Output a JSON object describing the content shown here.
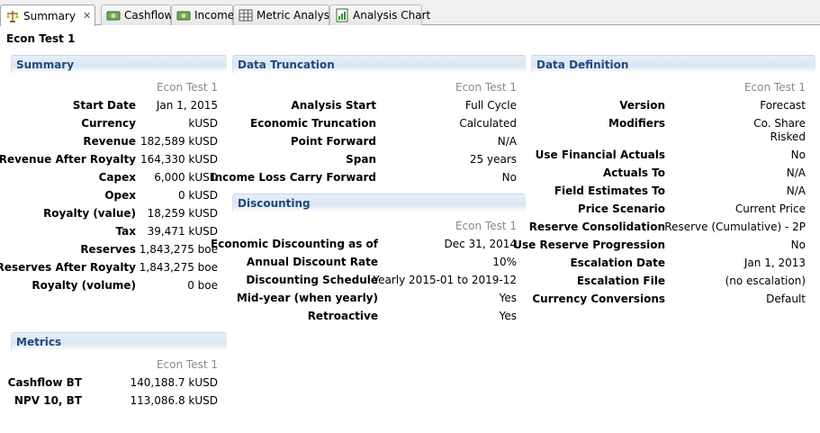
{
  "tabs": [
    {
      "label": "Summary",
      "icon": "summary-scale-icon"
    },
    {
      "label": "Cashflow",
      "icon": "money-icon"
    },
    {
      "label": "Income",
      "icon": "money-icon"
    },
    {
      "label": "Metric Analysis",
      "icon": "grid-icon"
    },
    {
      "label": "Analysis Chart",
      "icon": "chart-icon"
    }
  ],
  "page_title": "Econ Test 1",
  "column_header": "Econ Test 1",
  "summary": {
    "title": "Summary",
    "rows": [
      {
        "label": "Start Date",
        "value": "Jan 1, 2015"
      },
      {
        "label": "Currency",
        "value": "kUSD"
      },
      {
        "label": "Revenue",
        "value": "182,589 kUSD"
      },
      {
        "label": "Revenue After Royalty",
        "value": "164,330 kUSD"
      },
      {
        "label": "Capex",
        "value": "6,000 kUSD"
      },
      {
        "label": "Opex",
        "value": "0 kUSD"
      },
      {
        "label": "Royalty (value)",
        "value": "18,259 kUSD"
      },
      {
        "label": "Tax",
        "value": "39,471 kUSD"
      },
      {
        "label": "Reserves",
        "value": "1,843,275 boe"
      },
      {
        "label": "Reserves After Royalty",
        "value": "1,843,275 boe"
      },
      {
        "label": "Royalty (volume)",
        "value": "0 boe"
      }
    ]
  },
  "metrics": {
    "title": "Metrics",
    "rows": [
      {
        "label": "Cashflow BT",
        "value": "140,188.7 kUSD"
      },
      {
        "label": "NPV 10, BT",
        "value": "113,086.8 kUSD"
      }
    ]
  },
  "truncation": {
    "title": "Data Truncation",
    "rows": [
      {
        "label": "Analysis Start",
        "value": "Full Cycle"
      },
      {
        "label": "Economic Truncation",
        "value": "Calculated"
      },
      {
        "label": "Point Forward",
        "value": "N/A"
      },
      {
        "label": "Span",
        "value": "25 years"
      },
      {
        "label": "Income Loss Carry Forward",
        "value": "No"
      }
    ]
  },
  "discounting": {
    "title": "Discounting",
    "rows": [
      {
        "label": "Economic Discounting as of",
        "value": "Dec 31, 2014"
      },
      {
        "label": "Annual Discount Rate",
        "value": "10%"
      },
      {
        "label": "Discounting Schedule",
        "value": "Yearly 2015-01 to 2019-12"
      },
      {
        "label": "Mid-year (when yearly)",
        "value": "Yes"
      },
      {
        "label": "Retroactive",
        "value": "Yes"
      }
    ]
  },
  "definition": {
    "title": "Data Definition",
    "rows": [
      {
        "label": "Version",
        "value": "Forecast"
      },
      {
        "label": "Modifiers",
        "value": "Co. Share",
        "value2": "Risked"
      },
      {
        "label": "Use Financial Actuals",
        "value": "No"
      },
      {
        "label": "Actuals To",
        "value": "N/A"
      },
      {
        "label": "Field Estimates To",
        "value": "N/A"
      },
      {
        "label": "Price Scenario",
        "value": "Current Price"
      },
      {
        "label": "Reserve Consolidation",
        "value": "Reserve (Cumulative) - 2P"
      },
      {
        "label": "Use Reserve Progression",
        "value": "No"
      },
      {
        "label": "Escalation Date",
        "value": "Jan 1, 2013"
      },
      {
        "label": "Escalation File",
        "value": "(no escalation)"
      },
      {
        "label": "Currency Conversions",
        "value": "Default"
      }
    ]
  }
}
